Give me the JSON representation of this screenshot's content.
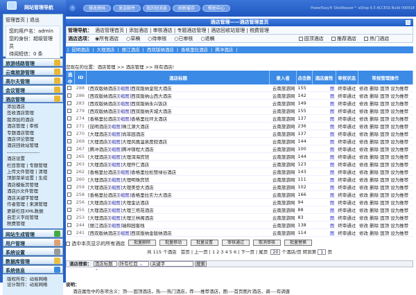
{
  "sidebar": {
    "title": "网站管理导航",
    "home": "管理首页",
    "sep": "|",
    "logout": "退出",
    "username": "您的用户名：admin",
    "role": "您的身份：超级管理员",
    "messages": "待阅短信：0 条",
    "menus_top": [
      "旅游线路管理",
      "云南旅游管理",
      "高尔夫管理",
      "会议管理",
      "酒店管理"
    ],
    "hotel_sub": [
      "添加酒店",
      "签收酒店管理",
      "我添加的酒店",
      "酒店管理 | 审核",
      "专题酒店管理",
      "酒店评论管理",
      "酒店回收站管理",
      "--------------------",
      "酒店设置",
      "栏目管理 | 专题管理",
      "上传文件管理 | 清理",
      "顶部菜单设置 | 生成",
      "酒店模板页管理",
      "酒店JS文件管理",
      "酒店关键字管理",
      "作者管理 | 来源管理",
      "更新栏目XML数据",
      "自定义字段管理",
      "税费管理"
    ],
    "menus_bottom": [
      "网站生成管理",
      "用户管理",
      "系统设置",
      "数据库管理",
      "系统信息"
    ],
    "copyright": "版权所有：动易网络",
    "designer": "设计制作：动易网络"
  },
  "topbar": {
    "buttons": [
      "修改密码",
      "发送邮件",
      "我的短消息",
      "刷新缓存",
      "帮助中心"
    ],
    "version": "PowerEasy® SiteWeaver™ eShop 6.5 ACCESS Build 090918"
  },
  "panel": {
    "title": "酒店管理——酒店管理首页",
    "nav_label": "管理导航：",
    "nav": [
      "酒店管理首页",
      "添加酒店",
      "审核酒店",
      "专题酒店管理",
      "酒店回收站管理",
      "税费管理"
    ],
    "opt_label": "酒店选项：",
    "options": [
      "所有酒店",
      "草稿",
      "待审核",
      "已审核",
      "退稿"
    ],
    "checks": [
      "固顶酒店",
      "推荐酒店",
      "热门酒店"
    ]
  },
  "tabs": [
    "昆明酒店",
    "大理酒店",
    "丽江酒店",
    "西双版纳酒店",
    "香格里拉酒店",
    "腾冲酒店"
  ],
  "position": "您现在的位置：酒店管理 >> 酒店管理 >> 所有酒店!",
  "table": {
    "headers": [
      "选中",
      "ID",
      "酒店标题",
      "录入者",
      "点击数",
      "酒店属性",
      "审核状态",
      "常规管理操作"
    ],
    "thumb": "[缩图]",
    "author": "云南旅游网",
    "attr": "图",
    "status": "终审通过",
    "ops": "修改 删除 固顶 设为推荐",
    "rows": [
      [
        "288",
        "[西双版纳酒店]",
        "西双版纳皇冠大酒店",
        "155"
      ],
      [
        "286",
        "[西双版纳酒店]",
        "西双版纳山西大酒店",
        "142"
      ],
      [
        "283",
        "[西双版纳酒店]",
        "西双版纳永兴饭店",
        "149"
      ],
      [
        "279",
        "[西双版纳酒店]",
        "西双版纳天城大酒店",
        "155"
      ],
      [
        "274",
        "[香格里拉酒店]",
        "香格里拉环太酒店",
        "137"
      ],
      [
        "271",
        "[昆明酒店]",
        "珠江源大酒店",
        "236"
      ],
      [
        "270",
        "[大理酒店]",
        "尚菲园酒店",
        "137"
      ],
      [
        "269",
        "[大理酒店]",
        "大理风凰温泉度假酒店",
        "144"
      ],
      [
        "267",
        "[腾冲酒店]",
        "腾冲锦程大酒店",
        "100"
      ],
      [
        "265",
        "[大理酒店]",
        "大理洱海宾馆",
        "144"
      ],
      [
        "263",
        "[大理酒店]",
        "大理怀仁酒店",
        "123"
      ],
      [
        "262",
        "[香格里拉酒店]",
        "香格里拉松赞绿谷酒店",
        "143"
      ],
      [
        "260",
        "[大理酒店]",
        "大理明珠宾馆",
        "111"
      ],
      [
        "259",
        "[大理酒店]",
        "大理美登大酒店",
        "102"
      ],
      [
        "258",
        "[香格里拉酒店]",
        "香格里拉实力大酒店",
        "166"
      ],
      [
        "256",
        "[大理酒店]",
        "大理金达酒店",
        "94"
      ],
      [
        "255",
        "[大理酒店]",
        "大理三塔苑酒店",
        "88"
      ],
      [
        "253",
        "[大理酒店]",
        "大理兰林阁酒店",
        "83"
      ],
      [
        "244",
        "[丽江酒店]",
        "瑞和园客栈",
        "138"
      ],
      [
        "241",
        "[西双版纳酒店]",
        "西双版纳金版纳酒店",
        "114"
      ]
    ]
  },
  "select_all": "选中本页显示的所有酒店",
  "batch": [
    "批量删除",
    "批量移动",
    "批量设置",
    "审核通过",
    "取消审核",
    "批量替换"
  ],
  "pager": {
    "total": "共 115 个酒店",
    "first": "首页 | 上一页 |",
    "pages": "1 2 3 4 5 6",
    "next": "| 下一页 | 尾页",
    "per_page": "20",
    "per_label": "个酒店/页  转到第",
    "goto": "1",
    "page_unit": "页"
  },
  "search": {
    "label": "酒店搜索：",
    "field": "酒店标题",
    "column": "所有栏目",
    "keyword": "关键字",
    "button": "搜索"
  },
  "note": {
    "title": "说明：",
    "text": "酒店属性中的各项含义：顶----固顶酒店，热----热门酒店，荐----推荐酒店，图----首页图片酒店，调----有调查"
  }
}
